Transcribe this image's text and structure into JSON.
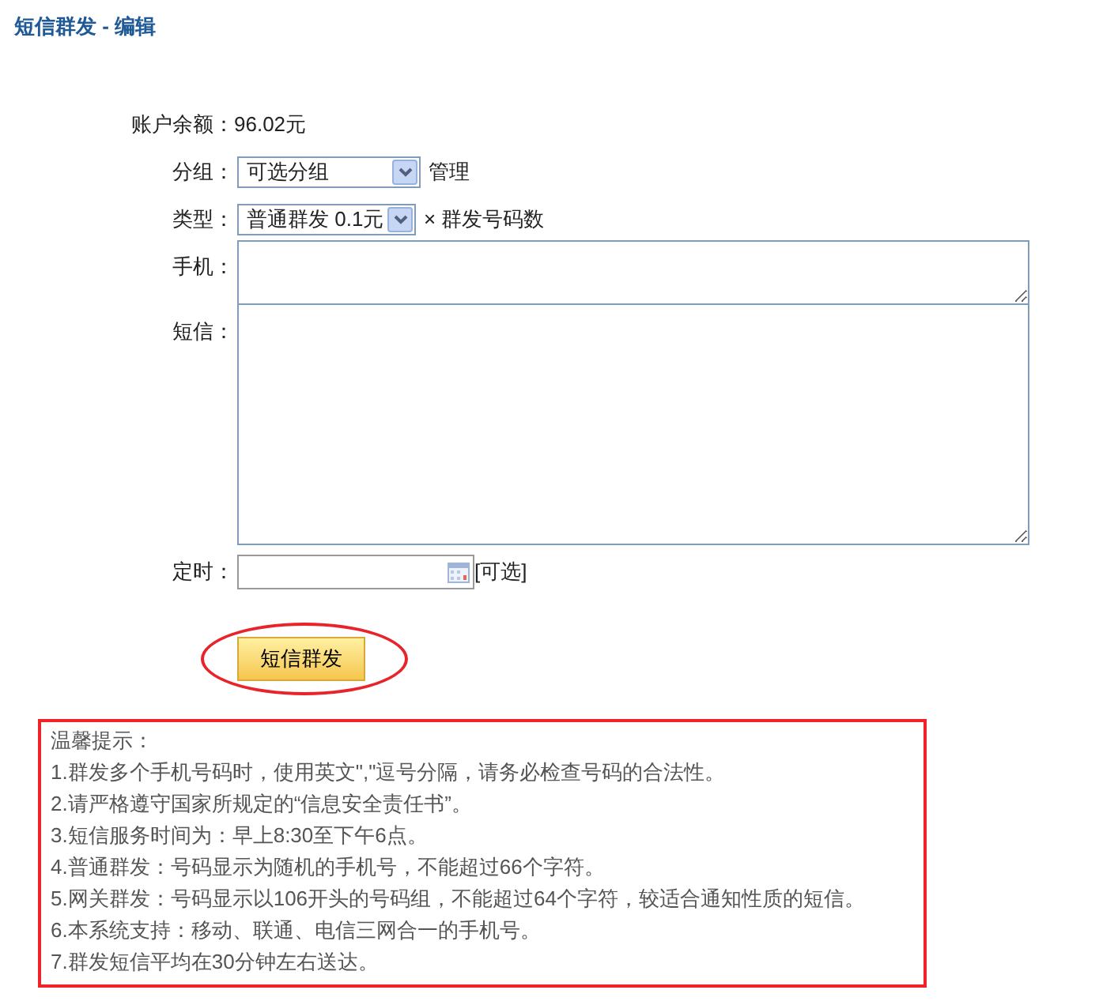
{
  "page_title": "短信群发 - 编辑",
  "form": {
    "balance": {
      "label": "账户余额：",
      "value": "96.02元"
    },
    "group": {
      "label": "分组：",
      "selected_option": "可选分组",
      "link": "管理"
    },
    "type": {
      "label": "类型：",
      "selected_option": "普通群发 0.1元",
      "suffix": "× 群发号码数"
    },
    "phone": {
      "label": "手机："
    },
    "message": {
      "label": "短信："
    },
    "schedule": {
      "label": "定时：",
      "hint": "[可选]"
    },
    "submit": "短信群发"
  },
  "notice": {
    "title": "温馨提示：",
    "lines": [
      "1.群发多个手机号码时，使用英文\",\"逗号分隔，请务必检查号码的合法性。",
      "2.请严格遵守国家所规定的“信息安全责任书”。",
      "3.短信服务时间为：早上8:30至下午6点。",
      "4.普通群发：号码显示为随机的手机号，不能超过66个字符。",
      "5.网关群发：号码显示以106开头的号码组，不能超过64个字符，较适合通知性质的短信。",
      "6.本系统支持：移动、联通、电信三网合一的手机号。",
      "7.群发短信平均在30分钟左右送达。"
    ]
  }
}
